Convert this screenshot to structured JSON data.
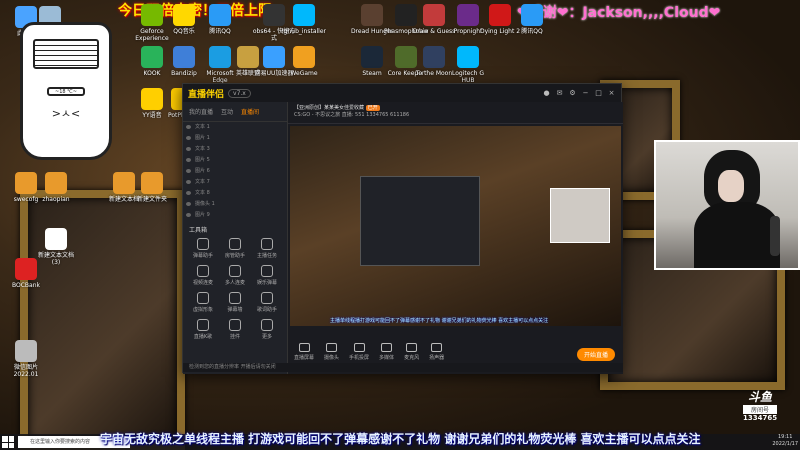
{
  "banner": {
    "left_text": "今日双倍来密！三倍上限~",
    "right_text": "❤感谢❤：Jackson,,,,Cloud❤"
  },
  "desktop_icons": [
    {
      "label": "此电脑",
      "color": "#4aa3ff"
    },
    {
      "label": "回收站",
      "color": "#9bbbd6"
    },
    {
      "label": "Geforce Experience",
      "color": "#76b900"
    },
    {
      "label": "QQ音乐",
      "color": "#ffd800"
    },
    {
      "label": "腾讯QQ",
      "color": "#2a9bf6"
    },
    {
      "label": "obs64 - 快捷方式",
      "color": "#333333"
    },
    {
      "label": "lghub_installer",
      "color": "#00b8fc"
    },
    {
      "label": "Dread Hunger",
      "color": "#5a4030"
    },
    {
      "label": "Phasmophobia",
      "color": "#222222"
    },
    {
      "label": "Draw & Guess",
      "color": "#c23b3b"
    },
    {
      "label": "Propnight",
      "color": "#6b2b8a"
    },
    {
      "label": "Dying Light 2",
      "color": "#d01818"
    },
    {
      "label": "腾讯QQ",
      "color": "#2a9bf6"
    },
    {
      "label": "KOOK",
      "color": "#29b35a"
    },
    {
      "label": "Bandizip",
      "color": "#3f7fd8"
    },
    {
      "label": "Microsoft Edge",
      "color": "#1b9de2"
    },
    {
      "label": "英雄联盟",
      "color": "#c8a040"
    },
    {
      "label": "网易UU加速器",
      "color": "#3aa0ff"
    },
    {
      "label": "WeGame",
      "color": "#f0a020"
    },
    {
      "label": "Steam",
      "color": "#1b2838"
    },
    {
      "label": "Core Keeper",
      "color": "#4f6b2a"
    },
    {
      "label": "To the Moon",
      "color": "#304060"
    },
    {
      "label": "Logitech G HUB",
      "color": "#00b8fc"
    },
    {
      "label": "YY语音",
      "color": "#ffcf00"
    },
    {
      "label": "PotPlayer",
      "color": "#ffcc00"
    },
    {
      "label": "swecofg",
      "color": "#e89a2c"
    },
    {
      "label": "zhaopian",
      "color": "#e89a2c"
    },
    {
      "label": "新建文本档",
      "color": "#e89a2c"
    },
    {
      "label": "新建文件夹",
      "color": "#e89a2c"
    },
    {
      "label": "新建文本文档 (3)",
      "color": "#ffffff"
    },
    {
      "label": "BOCBank",
      "color": "#d22"
    },
    {
      "label": "微信图片 2022.01",
      "color": "#bbbbbb"
    }
  ],
  "app": {
    "logo": "直播伴侣",
    "version": "v7.x",
    "tabs": [
      "我的直播",
      "互动",
      "直播间"
    ],
    "active_tab": "直播间",
    "scenes": [
      "文本 1",
      "图片 1",
      "文本 3",
      "图片 5",
      "图片 6",
      "文本 7",
      "文本 8",
      "摄像头 1",
      "图片 9"
    ],
    "toolbox_title": "工具箱",
    "tools": [
      "弹幕助手",
      "房管助手",
      "主播任务",
      "视频连麦",
      "多人连麦",
      "娱乐弹幕",
      "虚拟形象",
      "弹幕墙",
      "歌词助手",
      "直播K歌",
      "挂件",
      "更多"
    ],
    "room_title": "【亚洲原创】某某美女佳爱收藏",
    "room_badge": "已开",
    "room_cat": "CS:GO - 不思议之旅",
    "room_stat_a": "直播: 551",
    "room_stat_b": "1334765",
    "room_stat_c": "611186",
    "controls": [
      "直播屏幕",
      "摄像头",
      "手机投屏",
      "多媒体",
      "麦克风",
      "扬声器"
    ],
    "start_live": "开始直播",
    "status": "检测到您的直播分辨率 开播后请勿关闭",
    "preview_ticker": "主播单线程播打游戏可能回不了弹幕感谢不了礼物 谢谢兄弟们的礼物荧光棒 喜欢主播可以点点关注"
  },
  "sticker": {
    "display": "~18 ℃~",
    "face": ">ㅅ<"
  },
  "danmaku": "宇宙无敌究极之单线程主播 打游戏可能回不了弹幕感谢不了礼物 谢谢兄弟们的礼物荧光棒  喜欢主播可以点点关注",
  "taskbar": {
    "search_placeholder": "在这里输入你要搜索的内容"
  },
  "watermark": {
    "logo": "斗鱼",
    "room_label": "房间号",
    "room_number": "1334765"
  },
  "clock": {
    "time": "19:11",
    "date": "2022/1/17"
  }
}
